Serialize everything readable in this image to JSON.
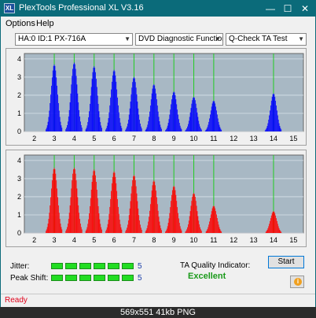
{
  "window": {
    "title": "PlexTools Professional XL V3.16",
    "icon_label": "XL",
    "minimize_glyph": "—",
    "maximize_glyph": "☐",
    "close_glyph": "✕"
  },
  "menu": {
    "options": "Options",
    "help": "Help"
  },
  "toolbar": {
    "drive": "HA:0 ID:1  PX-716A",
    "function": "DVD Diagnostic Functions",
    "test": "Q-Check  TA Test"
  },
  "chart_data": [
    {
      "type": "bar",
      "x_ticks": [
        "2",
        "3",
        "4",
        "5",
        "6",
        "7",
        "8",
        "9",
        "10",
        "11",
        "12",
        "13",
        "14",
        "15"
      ],
      "y_ticks": [
        "0",
        "1",
        "2",
        "3",
        "4"
      ],
      "ylim": [
        0,
        4.3
      ],
      "xlim": [
        1.5,
        15.5
      ],
      "series": [
        {
          "color": "#0000ff",
          "peaks": [
            [
              3.0,
              3.7
            ],
            [
              4.0,
              3.8
            ],
            [
              5.0,
              3.6
            ],
            [
              6.0,
              3.4
            ],
            [
              7.0,
              3.0
            ],
            [
              8.0,
              2.6
            ],
            [
              9.0,
              2.2
            ],
            [
              10.0,
              1.9
            ],
            [
              11.0,
              1.7
            ],
            [
              14.0,
              2.1
            ]
          ]
        }
      ],
      "green_lines": [
        3,
        4,
        5,
        6,
        7,
        8,
        9,
        10,
        11,
        14
      ]
    },
    {
      "type": "bar",
      "x_ticks": [
        "2",
        "3",
        "4",
        "5",
        "6",
        "7",
        "8",
        "9",
        "10",
        "11",
        "12",
        "13",
        "14",
        "15"
      ],
      "y_ticks": [
        "0",
        "1",
        "2",
        "3",
        "4"
      ],
      "ylim": [
        0,
        4.3
      ],
      "xlim": [
        1.5,
        15.5
      ],
      "series": [
        {
          "color": "#ff0000",
          "peaks": [
            [
              3.0,
              3.6
            ],
            [
              4.0,
              3.6
            ],
            [
              5.0,
              3.5
            ],
            [
              6.0,
              3.4
            ],
            [
              7.0,
              3.2
            ],
            [
              8.0,
              2.9
            ],
            [
              9.0,
              2.6
            ],
            [
              10.0,
              2.2
            ],
            [
              11.0,
              1.5
            ],
            [
              14.0,
              1.2
            ]
          ]
        }
      ],
      "green_lines": [
        3,
        4,
        5,
        6,
        7,
        8,
        9,
        10,
        11,
        14
      ]
    }
  ],
  "jitter": {
    "label": "Jitter:",
    "value": "5",
    "level": 6,
    "max": 6
  },
  "peak_shift": {
    "label": "Peak Shift:",
    "value": "5",
    "level": 6,
    "max": 6
  },
  "ta_quality": {
    "label": "TA Quality Indicator:",
    "value": "Excellent"
  },
  "buttons": {
    "start": "Start",
    "info_glyph": "i"
  },
  "status": {
    "text": "Ready"
  },
  "image_caption": "569x551  41kb  PNG"
}
